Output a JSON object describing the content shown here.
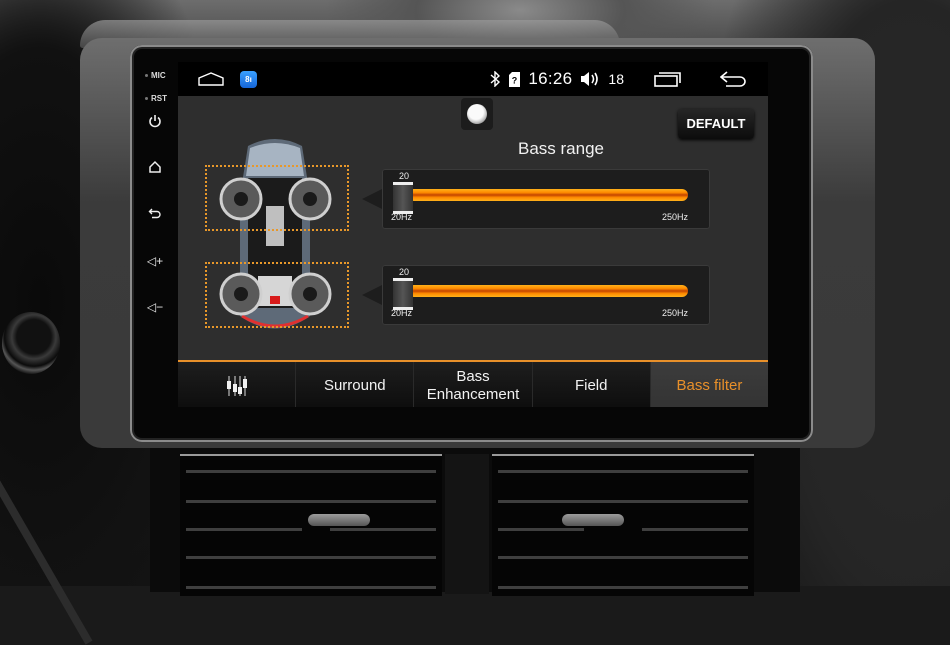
{
  "device": {
    "side_labels": {
      "mic": "MIC",
      "rst": "RST"
    },
    "side_buttons": [
      {
        "name": "power",
        "icon": "power-icon"
      },
      {
        "name": "home",
        "icon": "home-icon"
      },
      {
        "name": "back",
        "icon": "back-icon"
      },
      {
        "name": "volume-up",
        "icon": "volume-up-icon",
        "glyph": "◁+"
      },
      {
        "name": "volume-down",
        "icon": "volume-down-icon",
        "glyph": "◁−"
      }
    ]
  },
  "statusbar": {
    "home_icon": "home-outline-icon",
    "app_icon_label": "8ı",
    "bluetooth_icon": "bluetooth-icon",
    "sim_icon": "sim-unknown-icon",
    "time": "16:26",
    "volume_icon": "speaker-volume-icon",
    "volume_level": "18",
    "recents_icon": "recent-apps-icon",
    "back_icon": "back-arrow-icon"
  },
  "main": {
    "toggle_state": "off",
    "default_label": "DEFAULT",
    "section_title": "Bass range",
    "zones": [
      "front",
      "rear"
    ],
    "sliders": [
      {
        "zone": "front",
        "value": "20",
        "min_label": "20Hz",
        "max_label": "250Hz",
        "value_hz": 20,
        "min_hz": 20,
        "max_hz": 250
      },
      {
        "zone": "rear",
        "value": "20",
        "min_label": "20Hz",
        "max_label": "250Hz",
        "value_hz": 20,
        "min_hz": 20,
        "max_hz": 250
      }
    ]
  },
  "tabs": [
    {
      "label": "",
      "icon": "equalizer-icon",
      "active": false
    },
    {
      "label": "Surround",
      "active": false
    },
    {
      "label": "Bass\nEnhancement",
      "active": false
    },
    {
      "label": "Field",
      "active": false
    },
    {
      "label": "Bass filter",
      "active": true
    }
  ],
  "colors": {
    "accent": "#e8902a",
    "panel_bg": "#2e2e2e",
    "tab_active_bg": "#383838"
  }
}
